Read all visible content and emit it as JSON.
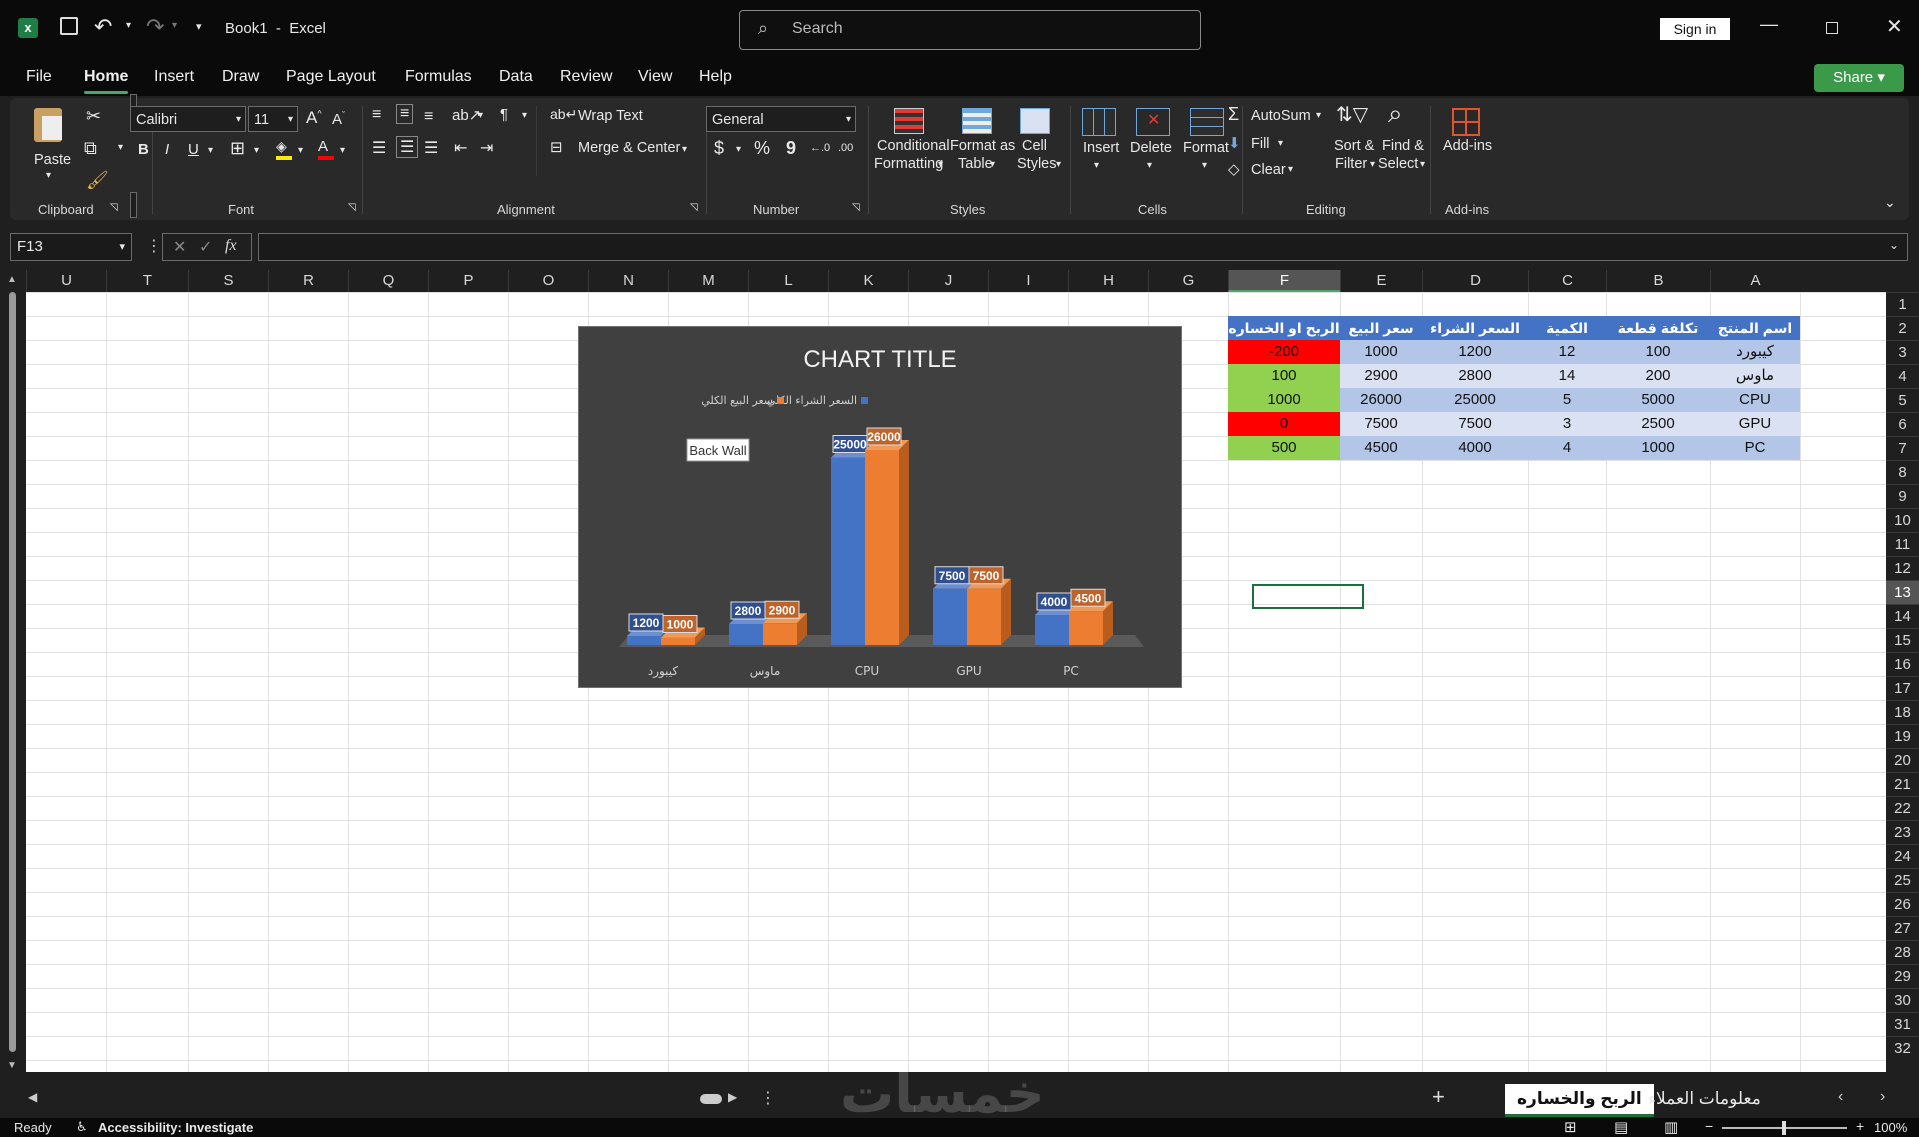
{
  "title_bar": {
    "doc_title": "Book1  -  Excel",
    "search_placeholder": "Search",
    "sign_in": "Sign in"
  },
  "menu": {
    "items": [
      "File",
      "Home",
      "Insert",
      "Draw",
      "Page Layout",
      "Formulas",
      "Data",
      "Review",
      "View",
      "Help"
    ],
    "active": "Home",
    "share": "Share"
  },
  "ribbon": {
    "clipboard": {
      "paste": "Paste",
      "label": "Clipboard"
    },
    "font": {
      "name": "Calibri",
      "size": "11",
      "label": "Font",
      "bold": "B",
      "italic": "I",
      "underline": "U"
    },
    "alignment": {
      "wrap_text": "Wrap Text",
      "merge_center": "Merge & Center",
      "label": "Alignment"
    },
    "number": {
      "format": "General",
      "label": "Number",
      "currency": "$",
      "percent": "%",
      "comma": "9"
    },
    "styles": {
      "conditional_1": "Conditional",
      "conditional_2": "Formatting",
      "format_table_1": "Format as",
      "format_table_2": "Table",
      "cell_styles_1": "Cell",
      "cell_styles_2": "Styles",
      "label": "Styles"
    },
    "cells": {
      "insert": "Insert",
      "delete": "Delete",
      "format": "Format",
      "label": "Cells"
    },
    "editing": {
      "autosum": "AutoSum",
      "fill": "Fill",
      "clear": "Clear",
      "sort_1": "Sort &",
      "sort_2": "Filter",
      "find_1": "Find &",
      "find_2": "Select",
      "label": "Editing"
    },
    "addins": {
      "addins": "Add-ins",
      "label": "Add-ins"
    }
  },
  "formula_bar": {
    "name_box": "F13",
    "formula": ""
  },
  "columns": [
    "U",
    "T",
    "S",
    "R",
    "Q",
    "P",
    "O",
    "N",
    "M",
    "L",
    "K",
    "J",
    "I",
    "H",
    "G",
    "F",
    "E",
    "D",
    "C",
    "B",
    "A"
  ],
  "selected_column": "F",
  "rows": [
    "1",
    "2",
    "3",
    "4",
    "5",
    "6",
    "7",
    "8",
    "9",
    "10",
    "11",
    "12",
    "13",
    "14",
    "15",
    "16",
    "17",
    "18",
    "19",
    "20",
    "21",
    "22",
    "23",
    "24",
    "25",
    "26",
    "27",
    "28",
    "29",
    "30",
    "31",
    "32"
  ],
  "selected_row": "13",
  "table": {
    "headers": [
      "اسم المنتج",
      "تكلفة قطعة الواحدة",
      "الكمية",
      "السعر الشراء الكلي",
      "سعر البيع الكلي",
      "الربح او الخساره"
    ],
    "rows": [
      [
        "كيبورد",
        "100",
        "12",
        "1200",
        "1000",
        "-200"
      ],
      [
        "ماوس",
        "200",
        "14",
        "2800",
        "2900",
        "100"
      ],
      [
        "CPU",
        "5000",
        "5",
        "25000",
        "26000",
        "1000"
      ],
      [
        "GPU",
        "2500",
        "3",
        "7500",
        "7500",
        "0"
      ],
      [
        "PC",
        "1000",
        "4",
        "4000",
        "4500",
        "500"
      ]
    ]
  },
  "chart_data": {
    "type": "bar",
    "title": "CHART TITLE",
    "categories": [
      "كيبورد",
      "ماوس",
      "CPU",
      "GPU",
      "PC"
    ],
    "series": [
      {
        "name": "السعر الشراء الكلي",
        "values": [
          1200,
          2800,
          25000,
          7500,
          4000
        ],
        "color": "#4472c4"
      },
      {
        "name": "سعر البيع الكلي",
        "values": [
          1000,
          2900,
          26000,
          7500,
          4500
        ],
        "color": "#ed7d31"
      }
    ],
    "ylim": [
      0,
      28000
    ],
    "legend": "top",
    "tooltip": "Back Wall",
    "grid": false
  },
  "sheet_tabs": {
    "active": "الربح والخساره",
    "other": "معلومات العملاء",
    "add": "+"
  },
  "status": {
    "ready": "Ready",
    "accessibility": "Accessibility: Investigate",
    "zoom": "100%"
  }
}
